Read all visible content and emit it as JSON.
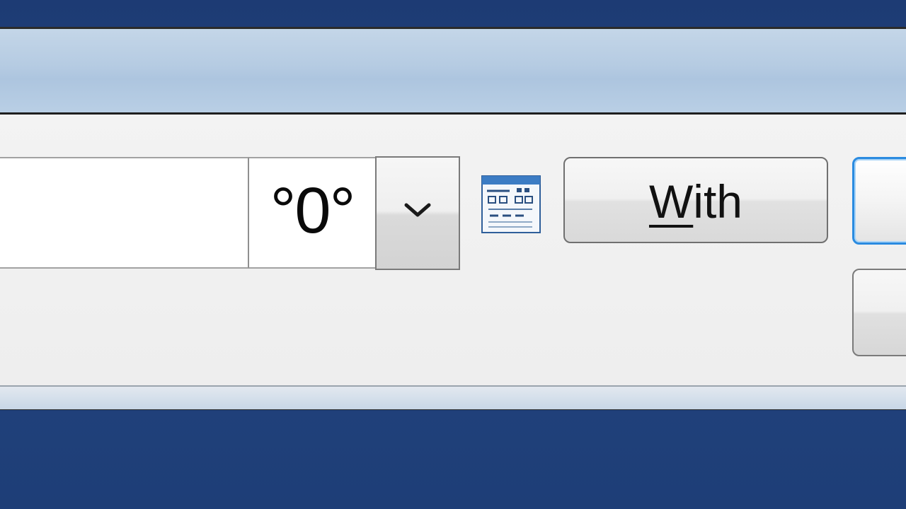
{
  "window": {
    "title": ""
  },
  "text_field": {
    "value": "",
    "placeholder": ""
  },
  "degree_field": {
    "value": "°0°"
  },
  "dropdown": {
    "icon": "chevron-down-icon"
  },
  "calendar": {
    "icon": "calendar-icon"
  },
  "with_button": {
    "mnemonic": "W",
    "rest": "ith"
  },
  "colors": {
    "desktop": "#1f3f78",
    "title_bar": "#b5cbe2",
    "client": "#f0f0f0",
    "focus_border": "#2b8be0"
  }
}
